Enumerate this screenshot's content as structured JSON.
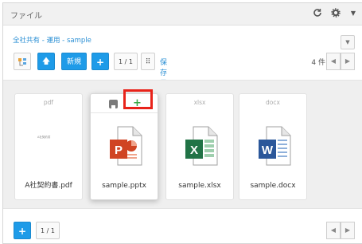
{
  "window": {
    "title": "ファイル"
  },
  "breadcrumb": "全社共有 - 運用 - sample",
  "toolbar": {
    "new_label": "新規",
    "add_label": "+",
    "page_label": "1 / 1",
    "sort_label": "保存日▾"
  },
  "summary": {
    "count_label": "4 件"
  },
  "files": [
    {
      "ext": "pdf",
      "name": "A社契約書.pdf",
      "type": "pdf",
      "preview_text": "A社契約書"
    },
    {
      "ext": "pptx",
      "name": "sample.pptx",
      "type": "pptx",
      "icon_letter": "P",
      "color": "#d04423"
    },
    {
      "ext": "xlsx",
      "name": "sample.xlsx",
      "type": "xlsx",
      "icon_letter": "X",
      "color": "#217346"
    },
    {
      "ext": "docx",
      "name": "sample.docx",
      "type": "docx",
      "icon_letter": "W",
      "color": "#2b579a"
    }
  ],
  "footer": {
    "add_label": "+",
    "page_label": "1 / 1"
  },
  "colors": {
    "accent": "#1e9be8",
    "highlight": "#e8231a",
    "plus": "#3aa845"
  }
}
